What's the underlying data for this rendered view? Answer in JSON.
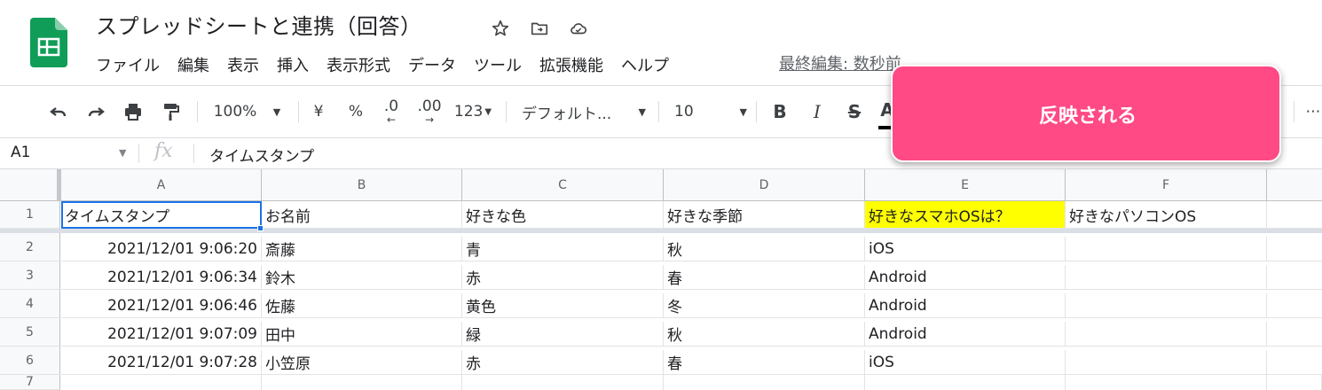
{
  "app": {
    "doc_title": "スプレッドシートと連携（回答）",
    "menu": [
      "ファイル",
      "編集",
      "表示",
      "挿入",
      "表示形式",
      "データ",
      "ツール",
      "拡張機能",
      "ヘルプ"
    ],
    "last_edit": "最終編集: 数秒前",
    "colors": {
      "brand_green": "#0f9d58",
      "selection_blue": "#1a73e8",
      "highlight_yellow": "#ffff00",
      "callout_pink": "#ff4a86"
    }
  },
  "toolbar": {
    "zoom": "100%",
    "currency": "¥",
    "percent": "%",
    "decimal_decrease": ".0",
    "decimal_increase": ".00",
    "more_formats": "123",
    "font": "デフォルト...",
    "font_size": "10",
    "bold": "B",
    "italic": "I",
    "strike": "S",
    "text_color": "A",
    "more": "⋮",
    "icons": [
      "undo-icon",
      "redo-icon",
      "print-icon",
      "paint-format-icon",
      "star-icon",
      "move-folder-icon",
      "cloud-status-icon"
    ]
  },
  "formula_bar": {
    "name_box": "A1",
    "fx": "fx",
    "content": "タイムスタンプ"
  },
  "sheet": {
    "columns": [
      "A",
      "B",
      "C",
      "D",
      "E",
      "F"
    ],
    "row_numbers": [
      "1",
      "2",
      "3",
      "4",
      "5",
      "6",
      "7"
    ],
    "header_row": [
      "タイムスタンプ",
      "お名前",
      "好きな色",
      "好きな季節",
      "好きなスマホOSは？",
      "好きなパソコンOS"
    ],
    "rows": [
      [
        "2021/12/01 9:06:20",
        "斎藤",
        "青",
        "秋",
        "iOS",
        ""
      ],
      [
        "2021/12/01 9:06:34",
        "鈴木",
        "赤",
        "春",
        "Android",
        ""
      ],
      [
        "2021/12/01 9:06:46",
        "佐藤",
        "黄色",
        "冬",
        "Android",
        ""
      ],
      [
        "2021/12/01 9:07:09",
        "田中",
        "緑",
        "秋",
        "Android",
        ""
      ],
      [
        "2021/12/01 9:07:28",
        "小笠原",
        "赤",
        "春",
        "iOS",
        ""
      ]
    ]
  },
  "callout": {
    "text": "反映される"
  }
}
